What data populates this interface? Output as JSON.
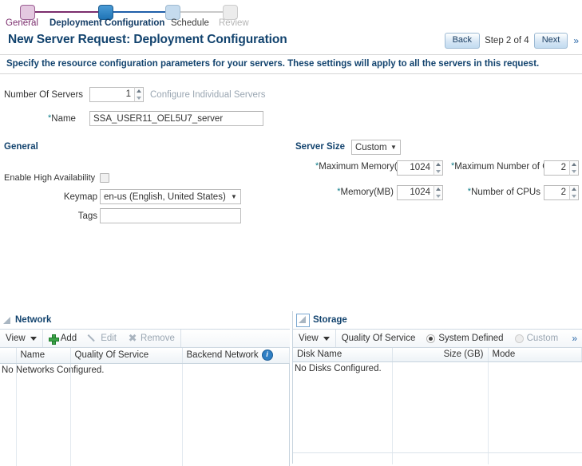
{
  "train": {
    "steps": [
      {
        "label": "General",
        "state": "done"
      },
      {
        "label": "Deployment Configuration",
        "state": "current"
      },
      {
        "label": "Schedule",
        "state": "next"
      },
      {
        "label": "Review",
        "state": "disabled"
      }
    ]
  },
  "header": {
    "title": "New Server Request: Deployment Configuration",
    "back_label": "Back",
    "step_text": "Step 2 of 4",
    "next_label": "Next",
    "more_glyph": "»"
  },
  "instruction": "Specify the resource configuration parameters for your servers. These settings will apply to all the servers in this request.",
  "top_form": {
    "number_of_servers_label": "Number Of Servers",
    "number_of_servers_value": "1",
    "configure_individual_servers_label": "Configure Individual Servers",
    "name_label": "Name",
    "name_value": "SSA_USER11_OEL5U7_server",
    "required_marker": "*"
  },
  "general": {
    "section_title": "General",
    "enable_ha_label": "Enable High Availability",
    "enable_ha_checked": false,
    "keymap_label": "Keymap",
    "keymap_value": "en-us (English, United States)",
    "tags_label": "Tags",
    "tags_value": ""
  },
  "server_size": {
    "section_title": "Server Size",
    "size_value": "Custom",
    "fields": [
      {
        "label": "Maximum Memory(MB)",
        "value": "1024",
        "required": "*"
      },
      {
        "label": "Maximum Number of CPUs",
        "value": "2",
        "required": "*"
      },
      {
        "label": "Memory(MB)",
        "value": "1024",
        "required": "*"
      },
      {
        "label": "Number of CPUs",
        "value": "2",
        "required": "*"
      }
    ]
  },
  "network_panel": {
    "title": "Network",
    "toolbar": {
      "view_label": "View",
      "add_label": "Add",
      "edit_label": "Edit",
      "remove_label": "Remove"
    },
    "columns": [
      "",
      "Name",
      "Quality Of Service",
      "Backend Network"
    ],
    "info_glyph": "i",
    "empty_message": "No Networks Configured."
  },
  "storage_panel": {
    "title": "Storage",
    "toolbar": {
      "view_label": "View",
      "qos_label": "Quality Of Service",
      "system_defined_label": "System Defined",
      "custom_label": "Custom",
      "system_defined_selected": true,
      "more_glyph": "»"
    },
    "columns": [
      "Disk Name",
      "Size (GB)",
      "Mode"
    ],
    "empty_message": "No Disks Configured."
  },
  "colors": {
    "title_blue": "#12436e",
    "done_purple": "#7b2d6d",
    "current_blue": "#1f5fa9",
    "required_teal": "#0a7a86",
    "add_green": "#3ea34a",
    "info_blue": "#2f7fc4"
  }
}
